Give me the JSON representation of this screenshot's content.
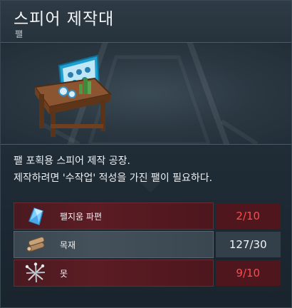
{
  "header": {
    "title": "스피어 제작대",
    "subtitle": "팰"
  },
  "description": {
    "line1": "팰 포획용 스피어 제작 공장.",
    "line2": "제작하려면 '수작업' 적성을 가진 팰이 필요하다."
  },
  "materials": [
    {
      "name": "팰지움 파편",
      "icon": "paldium-fragment-icon",
      "count": "2/10",
      "status": "insufficient"
    },
    {
      "name": "목재",
      "icon": "wood-icon",
      "count": "127/30",
      "status": "sufficient"
    },
    {
      "name": "못",
      "icon": "nails-icon",
      "count": "9/10",
      "status": "insufficient"
    }
  ],
  "colors": {
    "insufficient_text": "#ff4a4a",
    "insufficient_bg": "#4f161d",
    "sufficient_text": "#f2f4f6",
    "sufficient_bg": "#44515b"
  }
}
